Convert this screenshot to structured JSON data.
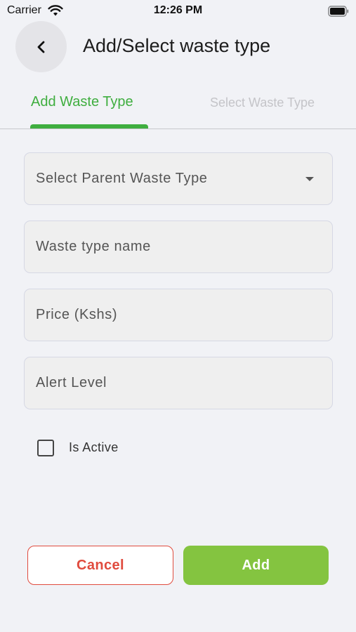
{
  "status_bar": {
    "carrier": "Carrier",
    "time": "12:26 PM"
  },
  "header": {
    "back_icon": "chevron-left-icon",
    "title": "Add/Select waste type"
  },
  "tabs": [
    {
      "label": "Add Waste Type",
      "active": true
    },
    {
      "label": "Select Waste Type",
      "active": false
    }
  ],
  "form": {
    "parent_waste_type": {
      "placeholder": "Select Parent Waste Type"
    },
    "waste_type_name": {
      "placeholder": "Waste type name"
    },
    "price": {
      "placeholder": "Price (Kshs)"
    },
    "alert_level": {
      "placeholder": "Alert Level"
    },
    "is_active": {
      "label": "Is Active",
      "checked": false
    }
  },
  "actions": {
    "cancel_label": "Cancel",
    "add_label": "Add"
  },
  "colors": {
    "accent_green": "#3fae3f",
    "add_button": "#84c440",
    "cancel_red": "#e04b3e",
    "background": "#f1f2f6"
  }
}
